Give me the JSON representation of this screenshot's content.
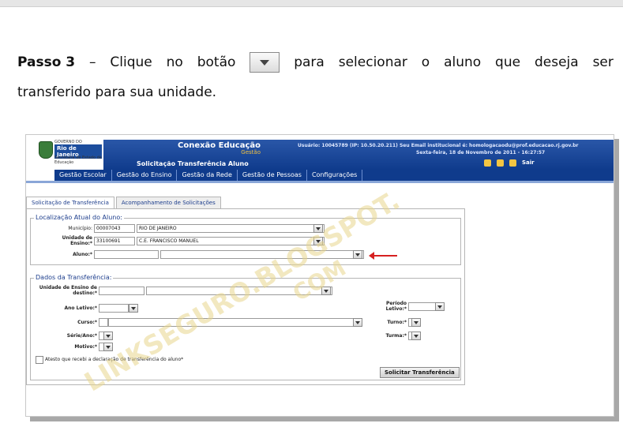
{
  "instruction": {
    "step": "Passo 3",
    "dash": "–",
    "words_before_button": [
      "Clique",
      "no",
      "botão"
    ],
    "words_after_button": [
      "para",
      "selecionar",
      "o",
      "aluno",
      "que",
      "deseja",
      "ser"
    ],
    "line2": "transferido para sua unidade."
  },
  "app": {
    "logo_gov": "GOVERNO DO",
    "logo_state": "Rio de Janeiro",
    "logo_secretaria": "Secretaria de Estado de Educação",
    "brand": "Conexão Educação",
    "brand_sub": "Gestão",
    "page_subtitle": "Solicitação Transferência Aluno",
    "user_info": "Usuário: 10045789 (IP: 10.50.20.211) Seu Email institucional é: homologacaodu@prof.educacao.rj.gov.br",
    "date_info": "Sexta-feira, 18 de Novembro de 2011 - 16:27:57",
    "exit_label": "Sair"
  },
  "nav": [
    "Gestão Escolar",
    "Gestão do Ensino",
    "Gestão da Rede",
    "Gestão de Pessoas",
    "Configurações"
  ],
  "tabs": [
    "Solicitação de Transferência",
    "Acompanhamento de Solicitações"
  ],
  "localizacao": {
    "legend": "Localização Atual do Aluno:",
    "municipio_label": "Município:",
    "municipio_code": "00007043",
    "municipio_name": "RIO DE JANEIRO",
    "unidade_label": "Unidade de Ensino:*",
    "unidade_code": "33100691",
    "unidade_name": "C.E. FRANCISCO MANUEL",
    "aluno_label": "Aluno:*"
  },
  "dados": {
    "legend": "Dados da Transferência:",
    "unidade_destino_label": "Unidade de Ensino de destino:*",
    "ano_label": "Ano Letivo:*",
    "periodo_label": "Período Letivo:*",
    "curso_label": "Curso:*",
    "turno_label": "Turno:*",
    "serie_label": "Série/Ano:*",
    "turma_label": "Turma:*",
    "motivo_label": "Motivo:*",
    "atesto_label": "Atesto que recebi a declaração de transferência do aluno*",
    "submit_label": "Solicitar Transferência"
  },
  "watermark": [
    "LINKSEGURO.BLOGSPOT.",
    "COM"
  ],
  "colors": {
    "header_blue": "#0f3b8c",
    "arrow_red": "#d62020",
    "watermark": "#e7d68c"
  }
}
